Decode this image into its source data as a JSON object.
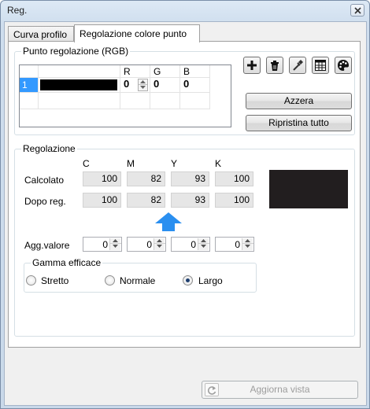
{
  "window": {
    "title": "Reg."
  },
  "tabs": [
    {
      "label": "Curva profilo",
      "active": false
    },
    {
      "label": "Regolazione colore punto",
      "active": true
    }
  ],
  "point_group": {
    "legend": "Punto regolazione (RGB)",
    "columns": [
      "R",
      "G",
      "B"
    ],
    "rows": [
      {
        "index": "1",
        "swatch_color": "#000000",
        "r": "0",
        "g": "0",
        "b": "0"
      }
    ],
    "toolbar_icons": [
      "plus-icon",
      "trash-icon",
      "eyedropper-icon",
      "table-icon",
      "palette-icon"
    ],
    "reset_label": "Azzera",
    "restore_all_label": "Ripristina tutto"
  },
  "adjust_group": {
    "legend": "Regolazione",
    "channels": [
      "C",
      "M",
      "Y",
      "K"
    ],
    "calculated_label": "Calcolato",
    "calculated": [
      "100",
      "82",
      "93",
      "100"
    ],
    "after_label": "Dopo reg.",
    "after": [
      "100",
      "82",
      "93",
      "100"
    ],
    "add_value_label": "Agg.valore",
    "add_values": [
      "0",
      "0",
      "0",
      "0"
    ],
    "preview_color": "#221e1f",
    "arrow_color": "#2a8ff0",
    "range_group": {
      "legend": "Gamma efficace",
      "options": [
        {
          "label": "Stretto",
          "selected": false
        },
        {
          "label": "Normale",
          "selected": false
        },
        {
          "label": "Largo",
          "selected": true
        }
      ]
    }
  },
  "footer": {
    "refresh_label": "Aggiorna vista",
    "enabled": false
  }
}
